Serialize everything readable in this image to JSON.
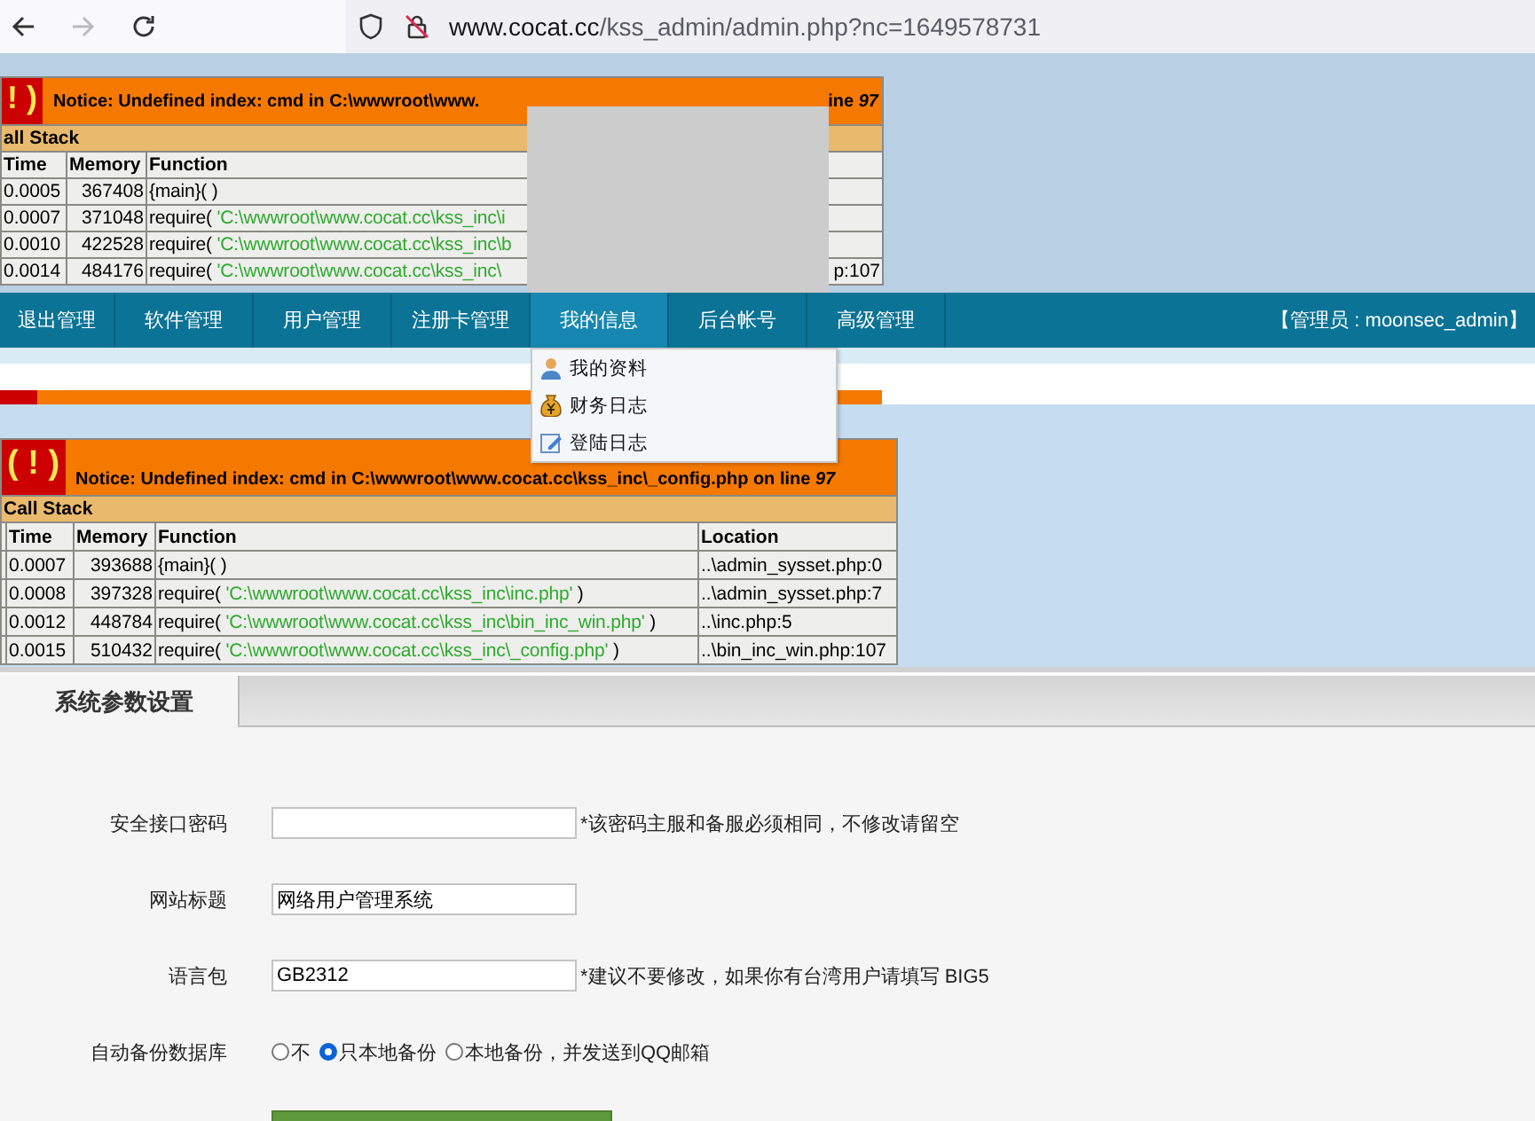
{
  "browser": {
    "back": {
      "disabled": false
    },
    "forward": {
      "disabled": true
    },
    "url": {
      "host": "www.cocat.cc",
      "path": "/kss_admin/admin.php?nc=1649578731"
    }
  },
  "errors": [
    {
      "icon": "! )",
      "message": "Notice: Undefined index: cmd in C:\\wwwroot\\www.",
      "message_end": "ine *97*",
      "stack_title": "all Stack",
      "columns": [
        "Time",
        "Memory",
        "Function"
      ],
      "rows": [
        {
          "time": "0.0005",
          "memory": "367408",
          "function": "{main}( )"
        },
        {
          "time": "0.0007",
          "memory": "371048",
          "function": "require( 'C:\\wwwroot\\www.cocat.cc\\kss_inc\\i"
        },
        {
          "time": "0.0010",
          "memory": "422528",
          "function": "require( 'C:\\wwwroot\\www.cocat.cc\\kss_inc\\b"
        },
        {
          "time": "0.0014",
          "memory": "484176",
          "function": "require( 'C:\\wwwroot\\www.cocat.cc\\kss_inc\\",
          "location": "p:107"
        }
      ]
    },
    {
      "icon": "( ! )",
      "message": "Notice: Undefined index: cmd in C:\\wwwroot\\www.cocat.cc\\kss_inc\\_config.php on line *97*",
      "stack_title": "Call Stack",
      "columns": [
        "Time",
        "Memory",
        "Function",
        "Location"
      ],
      "rows": [
        {
          "time": "0.0007",
          "memory": "393688",
          "function": "{main}( )",
          "location": "..\\admin_sysset.php:0"
        },
        {
          "time": "0.0008",
          "memory": "397328",
          "function": "require( 'C:\\wwwroot\\www.cocat.cc\\kss_inc\\inc.php' )",
          "location": "..\\admin_sysset.php:7"
        },
        {
          "time": "0.0012",
          "memory": "448784",
          "function": "require( 'C:\\wwwroot\\www.cocat.cc\\kss_inc\\bin_inc_win.php' )",
          "location": "..\\inc.php:5"
        },
        {
          "time": "0.0015",
          "memory": "510432",
          "function": "require( 'C:\\wwwroot\\www.cocat.cc\\kss_inc\\_config.php' )",
          "location": "..\\bin_inc_win.php:107"
        }
      ]
    }
  ],
  "nav": {
    "items": [
      {
        "label": "退出管理",
        "selected": false
      },
      {
        "label": "软件管理",
        "selected": false
      },
      {
        "label": "用户管理",
        "selected": false
      },
      {
        "label": "注册卡管理",
        "selected": false
      },
      {
        "label": "我的信息",
        "selected": true
      },
      {
        "label": "后台帐号",
        "selected": false
      },
      {
        "label": "高级管理",
        "selected": false
      }
    ],
    "admin_label": "【管理员 : moonsec_admin】"
  },
  "dropdown": [
    {
      "kind": "person",
      "label": "我的资料"
    },
    {
      "kind": "money",
      "label": "财务日志"
    },
    {
      "kind": "edit",
      "label": "登陆日志"
    }
  ],
  "tabs": [
    {
      "label": "系统参数设置",
      "selected": true
    }
  ],
  "form": {
    "fields": [
      {
        "kind": "text",
        "label": "安全接口密码",
        "note": "*该密码主服和备服必须相同，不修改请留空"
      },
      {
        "kind": "text",
        "label": "网站标题",
        "value": "网络用户管理系统"
      },
      {
        "kind": "text",
        "label": "语言包",
        "value": "GB2312",
        "note": "*建议不要修改，如果你有台湾用户请填写 BIG5"
      },
      {
        "kind": "radio",
        "label": "自动备份数据库",
        "options": [
          {
            "label": "不",
            "selected": false
          },
          {
            "label": "只本地备份",
            "selected": true
          },
          {
            "label": "本地备份，并发送到QQ邮箱",
            "selected": false
          }
        ]
      }
    ]
  }
}
